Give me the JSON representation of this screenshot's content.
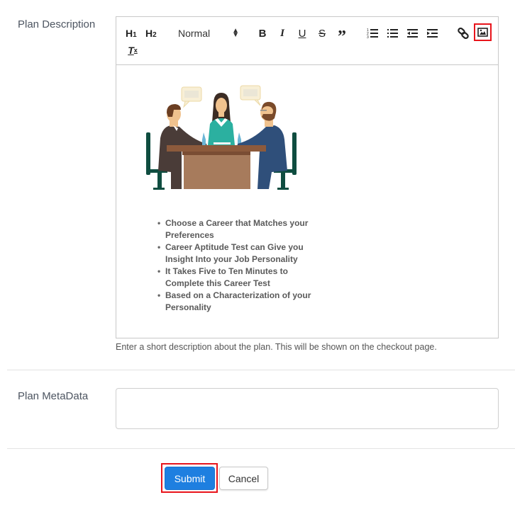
{
  "form": {
    "description_label": "Plan Description",
    "description_help": "Enter a short description about the plan. This will be shown on the checkout page.",
    "metadata_label": "Plan MetaData",
    "metadata_value": "",
    "metadata_placeholder": ""
  },
  "toolbar": {
    "h1": "H",
    "h1_sub": "1",
    "h2": "H",
    "h2_sub": "2",
    "format_select": "Normal",
    "bold": "B",
    "italic": "I",
    "underline": "U",
    "strike": "S",
    "blockquote": "”",
    "clear_format": "T",
    "clear_format_sub": "x",
    "icons": [
      "header-1-icon",
      "header-2-icon",
      "format-select",
      "bold-icon",
      "italic-icon",
      "underline-icon",
      "strike-icon",
      "blockquote-icon",
      "ordered-list-icon",
      "bullet-list-icon",
      "outdent-icon",
      "indent-icon",
      "link-icon",
      "image-icon",
      "clear-format-icon"
    ],
    "highlight_color": "#e8141b"
  },
  "editor_content": {
    "image": "meeting-illustration",
    "bullets": [
      "Choose a Career that Matches your Preferences",
      "Career Aptitude Test can Give you Insight Into your Job Personality",
      "It Takes Five to Ten Minutes to Complete this Career Test",
      "Based on a Characterization of your Personality"
    ]
  },
  "actions": {
    "submit_label": "Submit",
    "cancel_label": "Cancel",
    "submit_color": "#1e7fe0"
  }
}
